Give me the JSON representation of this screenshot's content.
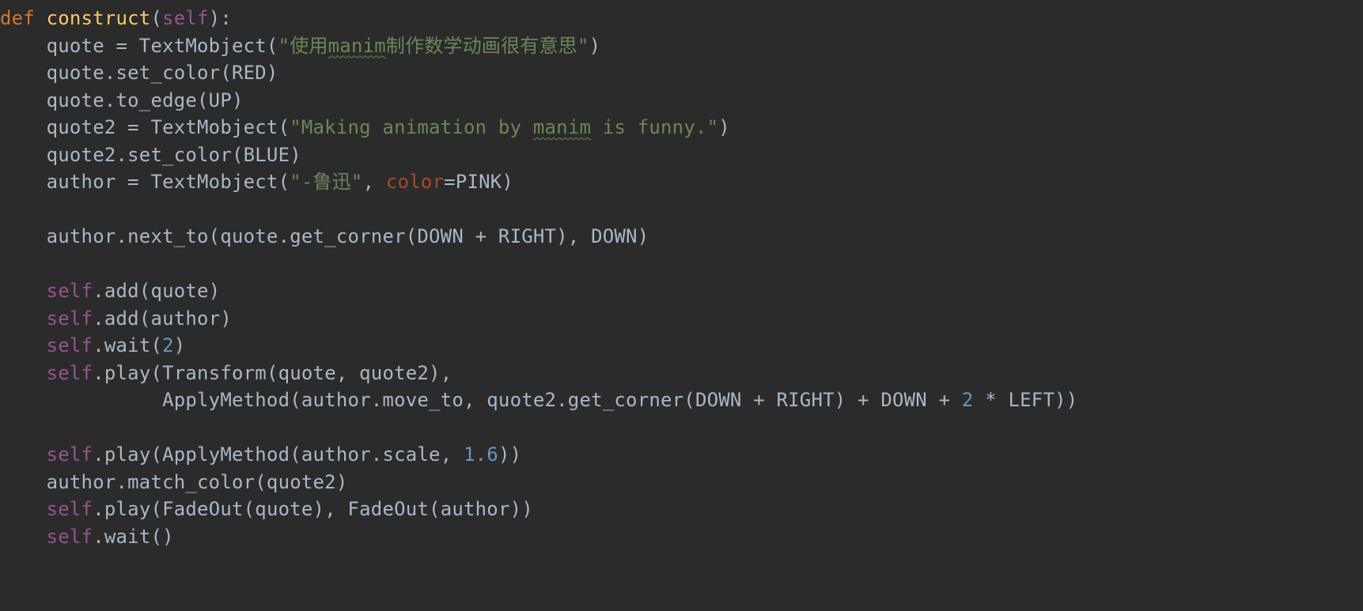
{
  "code": {
    "l1": {
      "kw": "def",
      "fn": "construct",
      "self": "self",
      "p": "(",
      "q": "):"
    },
    "l2": {
      "a": "    quote = TextMobject(",
      "s1": "\"使用",
      "sp": "manim",
      "s2": "制作数学动画很有意思\"",
      "b": ")"
    },
    "l3": {
      "a": "    quote.set_color(RED)"
    },
    "l4": {
      "a": "    quote.to_edge(UP)"
    },
    "l5": {
      "a": "    quote2 = TextMobject(",
      "s1": "\"Making animation by ",
      "sp": "manim",
      "s2": " is funny.\"",
      "b": ")"
    },
    "l6": {
      "a": "    quote2.set_color(BLUE)"
    },
    "l7": {
      "a": "    author = TextMobject(",
      "s1": "\"-鲁迅\"",
      "c": ", ",
      "kw": "color",
      "eq": "=PINK)"
    },
    "l8": {
      "a": ""
    },
    "l9": {
      "a": "    author.next_to(quote.get_corner(DOWN + RIGHT), DOWN)"
    },
    "l10": {
      "a": ""
    },
    "l11": {
      "s": "    ",
      "self": "self",
      "a": ".add(quote)"
    },
    "l12": {
      "s": "    ",
      "self": "self",
      "a": ".add(author)"
    },
    "l13": {
      "s": "    ",
      "self": "self",
      "a": ".wait(",
      "n": "2",
      "b": ")"
    },
    "l14": {
      "s": "    ",
      "self": "self",
      "a": ".play(Transform(quote, quote2),"
    },
    "l15": {
      "a": "              ApplyMethod(author.move_to, quote2.get_corner(DOWN + RIGHT) + DOWN + ",
      "n": "2",
      "b": " * LEFT))"
    },
    "l16": {
      "a": ""
    },
    "l17": {
      "s": "    ",
      "self": "self",
      "a": ".play(ApplyMethod(author.scale, ",
      "n": "1.6",
      "b": "))"
    },
    "l18": {
      "a": "    author.match_color(quote2)"
    },
    "l19": {
      "s": "    ",
      "self": "self",
      "a": ".play(FadeOut(quote), FadeOut(author))"
    },
    "l20": {
      "s": "    ",
      "self": "self",
      "a": ".wait()"
    }
  }
}
